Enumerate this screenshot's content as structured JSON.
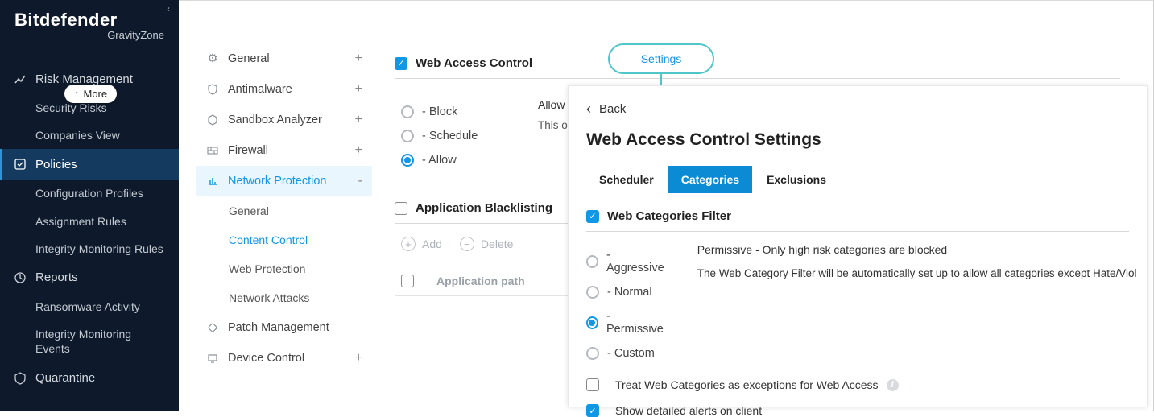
{
  "brand": {
    "name": "Bitdefender",
    "product": "GravityZone"
  },
  "more_pill": "More",
  "sidebar": {
    "items": [
      {
        "label": "Risk Management",
        "icon": "chart"
      },
      {
        "label": "Security Risks",
        "sub": true
      },
      {
        "label": "Companies View",
        "sub": true
      },
      {
        "label": "Policies",
        "icon": "shield",
        "active": true
      },
      {
        "label": "Configuration Profiles",
        "sub": true
      },
      {
        "label": "Assignment Rules",
        "sub": true
      },
      {
        "label": "Integrity Monitoring Rules",
        "sub": true
      },
      {
        "label": "Reports",
        "icon": "doc"
      },
      {
        "label": "Ransomware Activity",
        "sub": true
      },
      {
        "label": "Integrity Monitoring Events",
        "sub": true
      },
      {
        "label": "Quarantine",
        "icon": "quarantine"
      }
    ]
  },
  "secondary": {
    "items": [
      {
        "label": "General",
        "icon": "gear",
        "expand": "+"
      },
      {
        "label": "Antimalware",
        "icon": "am",
        "expand": "+"
      },
      {
        "label": "Sandbox Analyzer",
        "icon": "sandbox",
        "expand": "+"
      },
      {
        "label": "Firewall",
        "icon": "firewall",
        "expand": "+"
      },
      {
        "label": "Network Protection",
        "icon": "network",
        "expand": "-",
        "selected": true
      },
      {
        "label": "Patch Management",
        "icon": "patch"
      },
      {
        "label": "Device Control",
        "icon": "device",
        "expand": "+"
      }
    ],
    "subs": [
      {
        "label": "General"
      },
      {
        "label": "Content Control",
        "active": true
      },
      {
        "label": "Web Protection"
      },
      {
        "label": "Network Attacks"
      }
    ]
  },
  "content": {
    "wac_label": "Web Access Control",
    "settings_label": "Settings",
    "radio_block": "- Block",
    "radio_schedule": "- Schedule",
    "radio_allow": "- Allow",
    "allow_text": "Allow",
    "this_text": "This o",
    "app_black_label": "Application Blacklisting",
    "add_btn": "Add",
    "del_btn": "Delete",
    "col_app_path": "Application path"
  },
  "popover": {
    "back": "Back",
    "title": "Web Access Control Settings",
    "tabs": {
      "scheduler": "Scheduler",
      "categories": "Categories",
      "exclusions": "Exclusions"
    },
    "filter_label": "Web Categories Filter",
    "levels": {
      "aggressive": "- Aggressive",
      "normal": "- Normal",
      "permissive": "- Permissive",
      "custom": "- Custom"
    },
    "desc1": "Permissive - Only high risk categories are blocked",
    "desc2": "The Web Category Filter will be automatically set up to allow all categories except Hate/Viol",
    "treat_label": "Treat Web Categories as exceptions for Web Access",
    "show_alerts_label": "Show detailed alerts on client"
  }
}
